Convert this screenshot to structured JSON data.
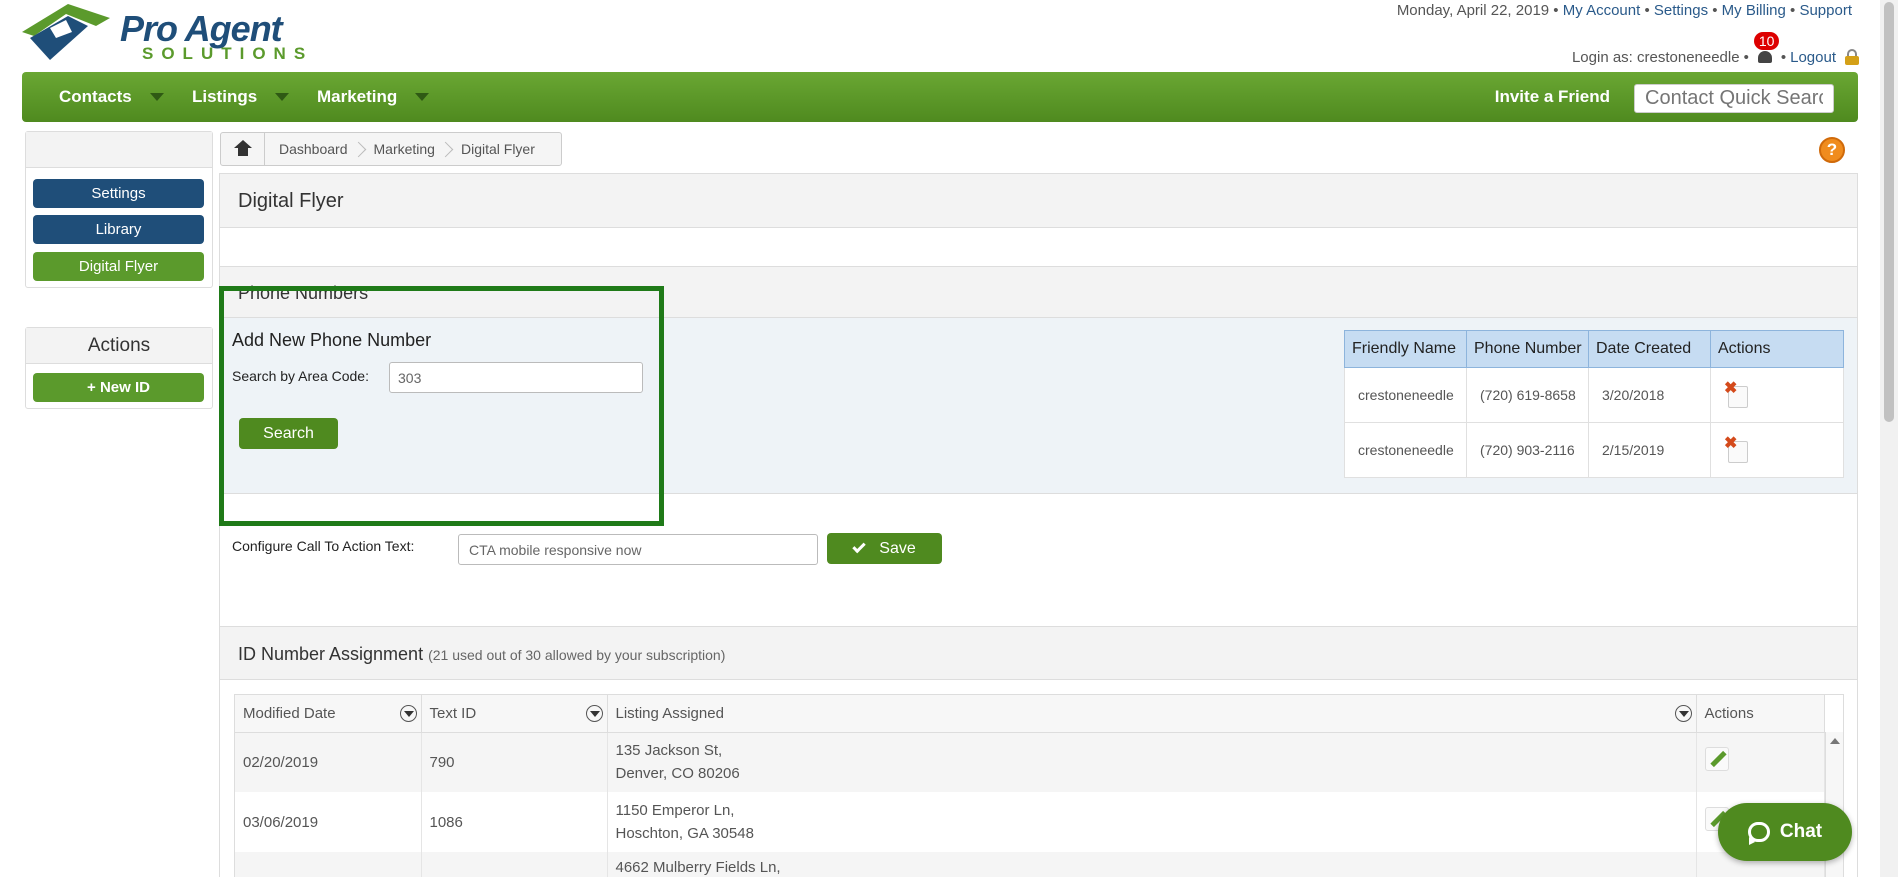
{
  "header": {
    "logo_line1": "Pro Agent",
    "logo_line2": "SOLUTIONS",
    "date": "Monday, April 22, 2019",
    "links": [
      "My Account",
      "Settings",
      "My Billing",
      "Support"
    ],
    "login_label": "Login as: crestoneneedle",
    "notification_count": "10",
    "logout": "Logout"
  },
  "nav": {
    "items": [
      "Contacts",
      "Listings",
      "Marketing"
    ],
    "invite": "Invite a Friend",
    "quick_search_placeholder": "Contact Quick Search"
  },
  "sidebar": {
    "buttons": [
      "Settings",
      "Library",
      "Digital Flyer"
    ],
    "actions_title": "Actions",
    "new_id": "+ New ID"
  },
  "breadcrumb": [
    "Dashboard",
    "Marketing",
    "Digital Flyer"
  ],
  "help": "?",
  "page_title": "Digital Flyer",
  "phone_section": {
    "title": "Phone Numbers",
    "add_title": "Add New Phone Number",
    "area_label": "Search by Area Code:",
    "area_value": "303",
    "search_button": "Search",
    "table": {
      "headers": [
        "Friendly Name",
        "Phone Number",
        "Date Created",
        "Actions"
      ],
      "rows": [
        [
          "crestoneneedle",
          "(720) 619-8658",
          "3/20/2018"
        ],
        [
          "crestoneneedle",
          "(720) 903-2116",
          "2/15/2019"
        ]
      ]
    }
  },
  "cta": {
    "label": "Configure Call To Action Text:",
    "value": "CTA mobile responsive now",
    "save": "Save"
  },
  "id_section": {
    "title": "ID Number Assignment",
    "subtitle": "(21 used out of 30 allowed by your subscription)",
    "headers": [
      "Modified Date",
      "Text ID",
      "Listing Assigned",
      "Actions"
    ],
    "rows": [
      {
        "date": "02/20/2019",
        "text_id": "790",
        "addr1": "135 Jackson St,",
        "addr2": "Denver, CO 80206"
      },
      {
        "date": "03/06/2019",
        "text_id": "1086",
        "addr1": "1150 Emperor Ln,",
        "addr2": "Hoschton, GA 30548"
      },
      {
        "date": "",
        "text_id": "",
        "addr1": "4662 Mulberry Fields Ln,",
        "addr2": ""
      }
    ]
  },
  "chat": "Chat",
  "colors": {
    "brand_green": "#5b9a2c",
    "brand_blue": "#1f4e79",
    "highlight": "#1f7a18"
  }
}
